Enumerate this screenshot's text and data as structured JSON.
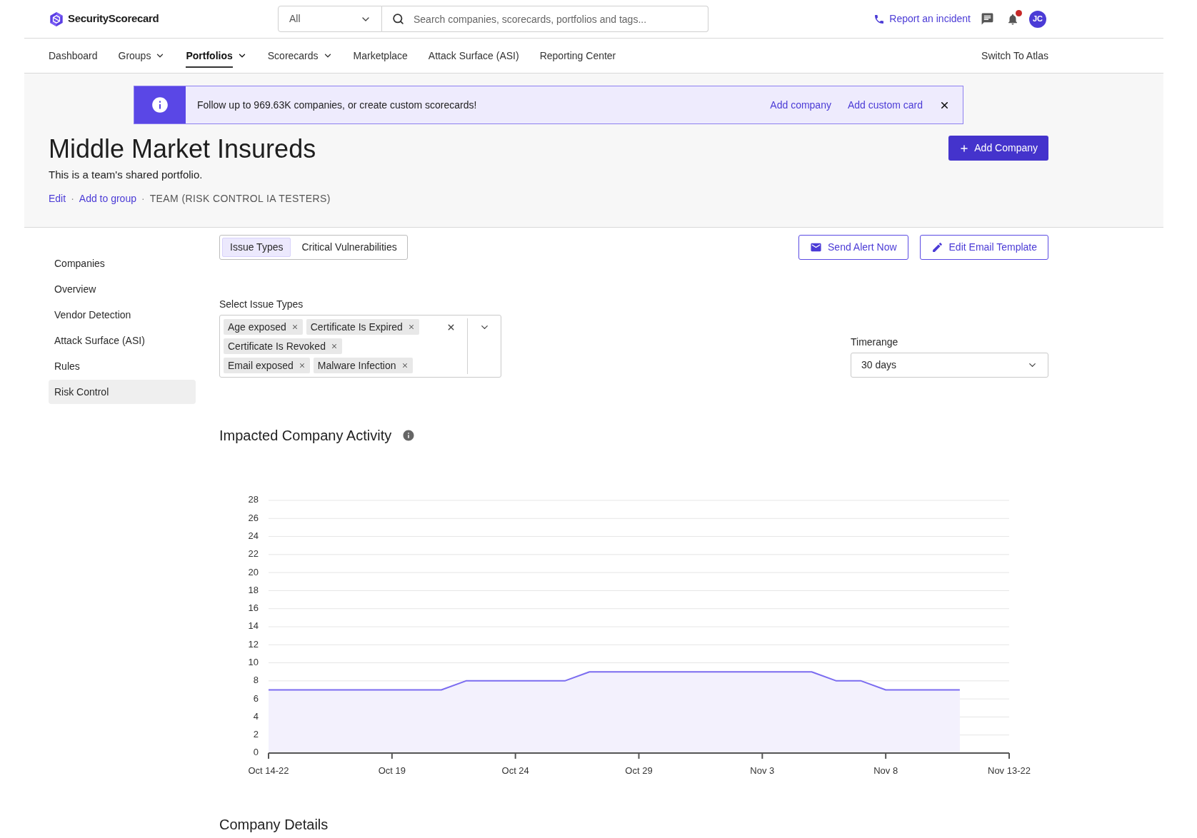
{
  "header": {
    "brand": "SecurityScorecard",
    "search": {
      "scope": "All",
      "placeholder": "Search companies, scorecards, portfolios and tags..."
    },
    "report_link": "Report an incident",
    "notifications": {
      "unread": true
    },
    "avatar": {
      "initials": "JC"
    }
  },
  "nav": {
    "items": [
      {
        "label": "Dashboard",
        "selected": false,
        "has_menu": false
      },
      {
        "label": "Groups",
        "selected": false,
        "has_menu": true
      },
      {
        "label": "Portfolios",
        "selected": true,
        "has_menu": true
      },
      {
        "label": "Scorecards",
        "selected": false,
        "has_menu": true
      },
      {
        "label": "Marketplace",
        "selected": false,
        "has_menu": false
      },
      {
        "label": "Attack Surface (ASI)",
        "selected": false,
        "has_menu": false
      },
      {
        "label": "Reporting Center",
        "selected": false,
        "has_menu": false
      }
    ],
    "switch_link": "Switch To Atlas"
  },
  "banner": {
    "message": "Follow up to 969.63K companies, or create custom scorecards!",
    "links": [
      "Add company",
      "Add custom card"
    ]
  },
  "portfolio": {
    "title": "Middle Market Insureds",
    "description": "This is a team's shared portfolio.",
    "meta": [
      {
        "kind": "link",
        "text": "Edit"
      },
      {
        "kind": "separator",
        "text": "·"
      },
      {
        "kind": "link",
        "text": "Add to group"
      },
      {
        "kind": "separator",
        "text": "·"
      },
      {
        "kind": "label",
        "text": "TEAM (RISK CONTROL IA TESTERS)"
      }
    ],
    "add_button": "Add Company"
  },
  "sidebar": {
    "items": [
      {
        "label": "Companies",
        "selected": false
      },
      {
        "label": "Overview",
        "selected": false
      },
      {
        "label": "Vendor Detection",
        "selected": false
      },
      {
        "label": "Attack Surface (ASI)",
        "selected": false
      },
      {
        "label": "Rules",
        "selected": false
      },
      {
        "label": "Risk Control",
        "selected": true
      }
    ]
  },
  "tabs": [
    {
      "label": "Issue Types",
      "selected": true
    },
    {
      "label": "Critical Vulnerabilities",
      "selected": false
    }
  ],
  "actions": [
    {
      "kind": "send",
      "label": "Send Alert Now"
    },
    {
      "kind": "edit",
      "label": "Edit Email Template"
    }
  ],
  "issue_types": {
    "label": "Select Issue Types",
    "tags": [
      "Age exposed",
      "Certificate Is Expired",
      "Certificate Is Revoked",
      "Email exposed",
      "Malware Infection"
    ]
  },
  "timerange": {
    "label": "Timerange",
    "value": "30 days"
  },
  "activity": {
    "title": "Impacted Company Activity",
    "chart_data": {
      "type": "area",
      "categories": [
        "Oct 14-22",
        null,
        null,
        null,
        null,
        "Oct 19",
        null,
        null,
        null,
        null,
        "Oct 24",
        null,
        null,
        null,
        null,
        "Oct 29",
        null,
        null,
        null,
        null,
        "Nov 3",
        null,
        null,
        null,
        null,
        "Nov 8",
        null,
        null,
        null,
        null,
        "Nov 13-22"
      ],
      "values": [
        7,
        7,
        7,
        7,
        7,
        7,
        7,
        7,
        8,
        8,
        8,
        8,
        8,
        9,
        9,
        9,
        9,
        9,
        9,
        9,
        9,
        9,
        9,
        8,
        8,
        7,
        7,
        7,
        7,
        null,
        null
      ],
      "ylim": [
        0,
        28
      ],
      "yticks": [
        0,
        2,
        4,
        6,
        8,
        10,
        12,
        14,
        16,
        18,
        20,
        22,
        24,
        26,
        28
      ],
      "grid": true
    }
  },
  "company_details": {
    "title": "Company Details"
  }
}
